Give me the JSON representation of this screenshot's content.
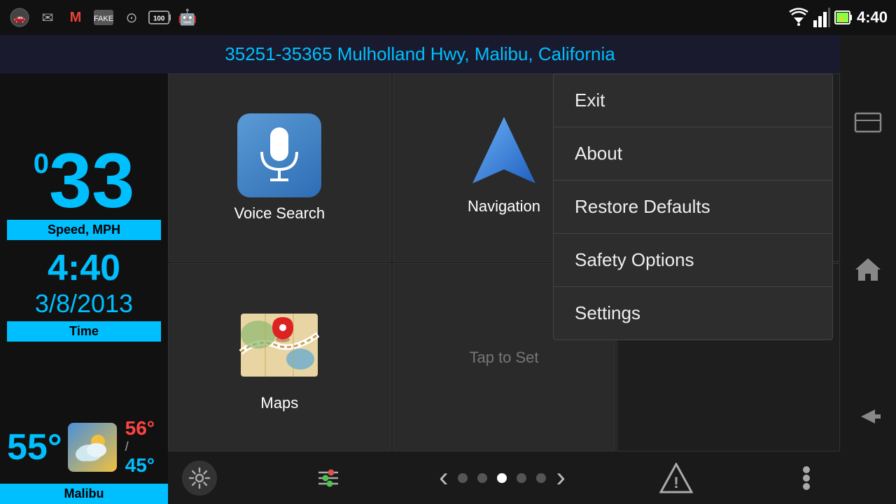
{
  "statusBar": {
    "time": "4:40",
    "icons": [
      "🚗",
      "✉",
      "M",
      "🎭",
      "☺",
      "💯",
      "👾"
    ]
  },
  "addressBar": {
    "text": "35251-35365 Mulholland Hwy, Malibu, California"
  },
  "leftPanel": {
    "speedValue": "33",
    "speedSuperscript": "0",
    "speedLabel": "Speed, MPH",
    "timeValue": "4:40",
    "dateValue": "3/8/2013",
    "timeLabel": "Time",
    "tempMain": "55°",
    "tempHigh": "56°",
    "tempLow": "45°",
    "locationLabel": "Malibu"
  },
  "tiles": [
    {
      "id": "voice-search",
      "label": "Voice Search"
    },
    {
      "id": "navigation",
      "label": "Navigation"
    },
    {
      "id": "unknown-top-right",
      "label": ""
    },
    {
      "id": "maps",
      "label": "Maps"
    },
    {
      "id": "tap-to-set",
      "label": "Tap to Set"
    },
    {
      "id": "unknown-bottom-right",
      "label": ""
    }
  ],
  "dropdownMenu": {
    "items": [
      {
        "id": "exit",
        "label": "Exit"
      },
      {
        "id": "about",
        "label": "About"
      },
      {
        "id": "restore-defaults",
        "label": "Restore Defaults"
      },
      {
        "id": "safety-options",
        "label": "Safety Options"
      },
      {
        "id": "settings",
        "label": "Settings"
      }
    ]
  },
  "bottomToolbar": {
    "gearLabel": "⚙",
    "slidersLabel": "⊟",
    "prevLabel": "‹",
    "nextLabel": "›",
    "dots": [
      false,
      false,
      true,
      false,
      false
    ],
    "warningLabel": "⚠",
    "moreLabel": "⋮"
  }
}
